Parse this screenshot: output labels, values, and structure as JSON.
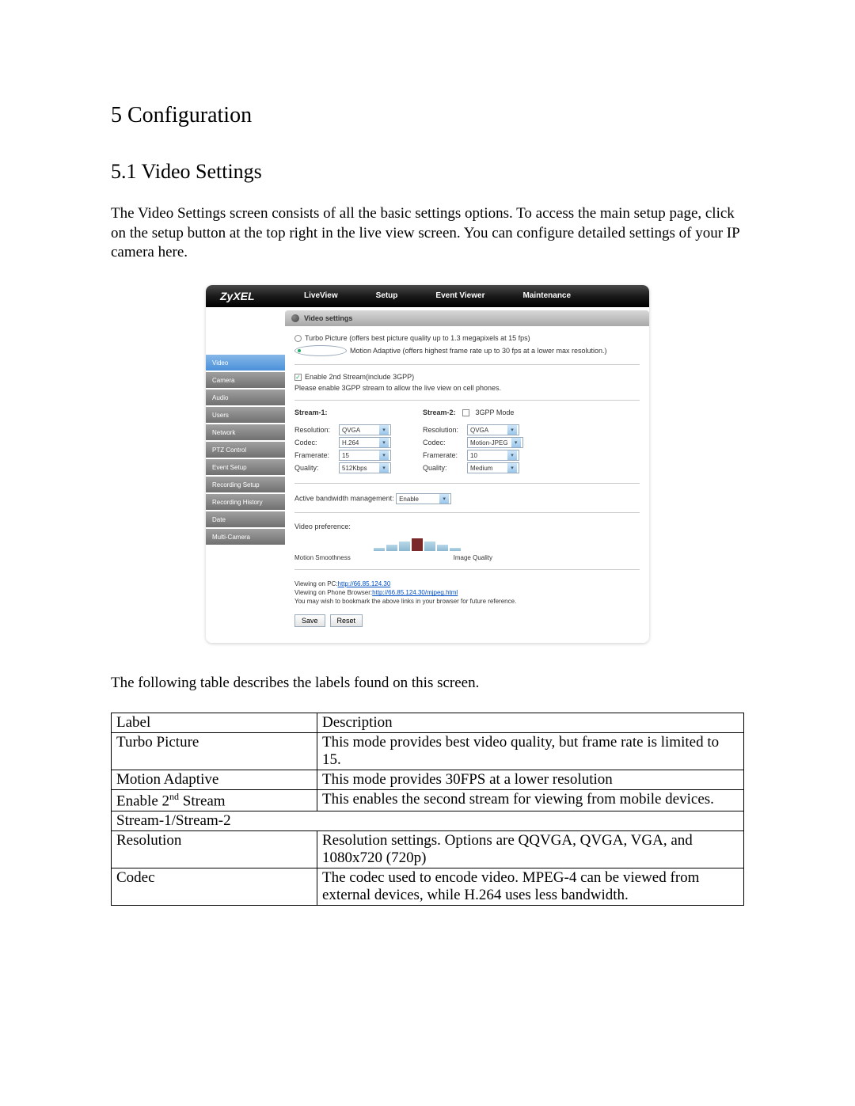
{
  "headings": {
    "h1": "5      Configuration",
    "h2": "5.1    Video Settings"
  },
  "paragraphs": {
    "intro": "The Video Settings screen consists of all the basic settings options. To access the main setup page, click on the setup button at the top right in the live view screen. You can configure detailed settings of your IP camera here.",
    "table_caption": "The following table describes the labels found on this screen."
  },
  "screenshot": {
    "brand": "ZyXEL",
    "tabs": [
      "LiveView",
      "Setup",
      "Event Viewer",
      "Maintenance"
    ],
    "sidebar": [
      "Video",
      "Camera",
      "Audio",
      "Users",
      "Network",
      "PTZ Control",
      "Event Setup",
      "Recording Setup",
      "Recording History",
      "Date",
      "Multi-Camera"
    ],
    "sidebar_active": 0,
    "panel_title": "Video settings",
    "mode": {
      "turbo_label": "Turbo Picture (offers best picture quality up to 1.3 megapixels at 15 fps)",
      "motion_label": "Motion Adaptive (offers highest frame rate up to 30 fps at a lower max resolution.)"
    },
    "enable_2nd": {
      "check_label": "Enable 2nd Stream(include 3GPP)",
      "note": "Please enable 3GPP stream to allow the live view on cell phones."
    },
    "stream1": {
      "title": "Stream-1:",
      "resolution": "QVGA",
      "codec": "H.264",
      "framerate": "15",
      "quality": "512Kbps"
    },
    "stream2": {
      "title": "Stream-2:",
      "mode_label": "3GPP Mode",
      "resolution": "QVGA",
      "codec": "Motion-JPEG",
      "framerate": "10",
      "quality": "Medium"
    },
    "field_labels": {
      "resolution": "Resolution:",
      "codec": "Codec:",
      "framerate": "Framerate:",
      "quality": "Quality:"
    },
    "bandwidth": {
      "label": "Active bandwidth management:",
      "value": "Enable"
    },
    "preference": {
      "label": "Video preference:",
      "axis_left": "Motion Smoothness",
      "axis_right": "Image Quality"
    },
    "links": {
      "pc_label": "Viewing on PC:",
      "pc_url": "http://66.85.124.30",
      "phone_label": "Viewing on Phone Browser:",
      "phone_url": "http://66.85.124.30/mjpeg.html",
      "note": "You may wish to bookmark the above links in your browser for future reference."
    },
    "buttons": {
      "save": "Save",
      "reset": "Reset"
    }
  },
  "table": {
    "header_label": "Label",
    "header_desc": "Description",
    "rows": [
      {
        "label": "Turbo Picture",
        "desc": "This mode provides best video quality, but frame rate is limited to 15."
      },
      {
        "label": "Motion Adaptive",
        "desc": "This mode provides 30FPS at a lower resolution"
      },
      {
        "label": "Enable 2<sup>nd</sup> Stream",
        "desc": "This enables the second stream for viewing from mobile devices."
      },
      {
        "label": "Stream-1/Stream-2",
        "desc": "",
        "span": true
      },
      {
        "label": "Resolution",
        "desc": "Resolution settings. Options are QQVGA, QVGA, VGA, and 1080x720 (720p)"
      },
      {
        "label": "Codec",
        "desc": "The codec used to encode video. MPEG-4 can be viewed from external devices, while H.264 uses less bandwidth."
      }
    ]
  },
  "chart_data": {
    "type": "bar",
    "note": "Video preference slider illustrated as bars between Motion Smoothness and Image Quality",
    "categories": [
      "1",
      "2",
      "3",
      "4",
      "5",
      "6",
      "7"
    ],
    "values": [
      4,
      8,
      12,
      16,
      12,
      8,
      4
    ],
    "selected_index": 3,
    "axis_left_label": "Motion Smoothness",
    "axis_right_label": "Image Quality"
  }
}
